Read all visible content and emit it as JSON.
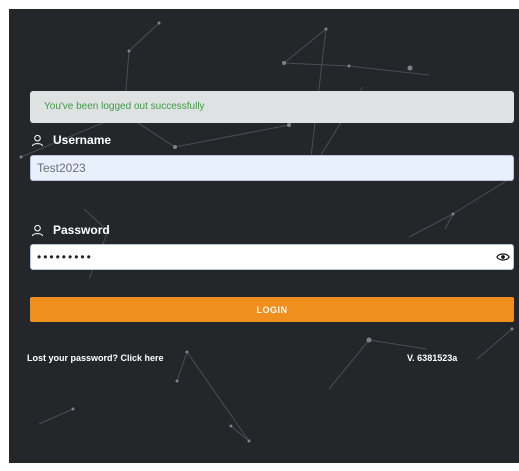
{
  "alert": {
    "message": "You've been logged out successfully"
  },
  "username": {
    "label": "Username",
    "value": "Test2023"
  },
  "password": {
    "label": "Password",
    "value": "•••••••••"
  },
  "login": {
    "label": "LOGIN"
  },
  "footer": {
    "lost_password": "Lost your password? Click here",
    "version": "V. 6381523a"
  }
}
